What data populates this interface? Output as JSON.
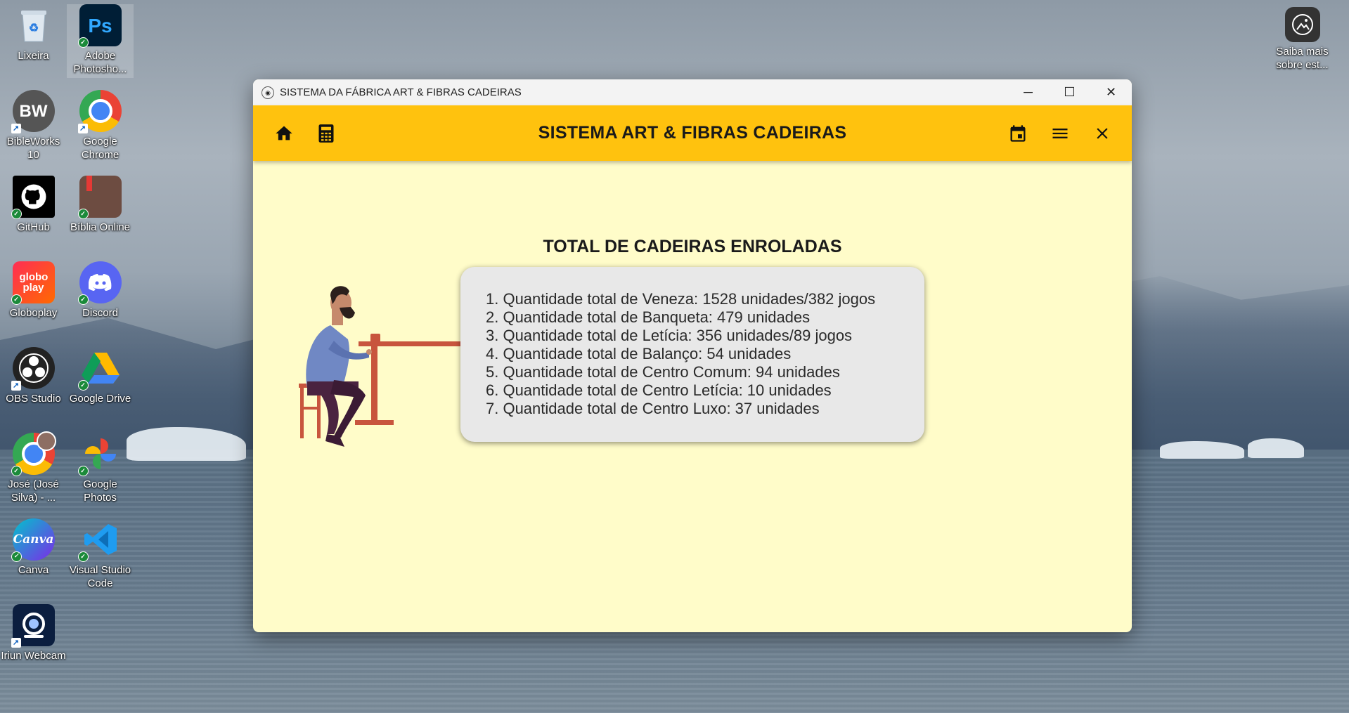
{
  "desktop": {
    "icons": [
      {
        "label": "Lixeira",
        "icon": "recycle-bin-icon"
      },
      {
        "label": "Adobe Photosho...",
        "icon": "photoshop-icon",
        "glyph": "Ps"
      },
      {
        "label": "BibleWorks 10",
        "icon": "bibleworks-icon",
        "glyph": "BW"
      },
      {
        "label": "Google Chrome",
        "icon": "chrome-icon"
      },
      {
        "label": "GitHub",
        "icon": "github-icon"
      },
      {
        "label": "Bíblia Online",
        "icon": "bible-online-icon"
      },
      {
        "label": "Globoplay",
        "icon": "globoplay-icon",
        "glyph": "globo play"
      },
      {
        "label": "Discord",
        "icon": "discord-icon"
      },
      {
        "label": "OBS Studio",
        "icon": "obs-icon"
      },
      {
        "label": "Google Drive",
        "icon": "google-drive-icon"
      },
      {
        "label": "José (José Silva) - ...",
        "icon": "chrome-profile-icon"
      },
      {
        "label": "Google Photos",
        "icon": "google-photos-icon"
      },
      {
        "label": "Canva",
        "icon": "canva-icon",
        "glyph": "Canva"
      },
      {
        "label": "Visual Studio Code",
        "icon": "vscode-icon"
      },
      {
        "label": "Iriun Webcam",
        "icon": "iriun-webcam-icon"
      },
      {
        "label": "Saiba mais sobre est...",
        "icon": "learn-more-icon"
      }
    ]
  },
  "window": {
    "title": "SISTEMA DA FÁBRICA ART & FIBRAS CADEIRAS",
    "minimize": "─",
    "maximize": "☐",
    "close": "✕"
  },
  "appbar": {
    "title": "SISTEMA ART & FIBRAS CADEIRAS",
    "left_icons": [
      "home-icon",
      "calculator-icon"
    ],
    "right_icons": [
      "calendar-icon",
      "menu-icon",
      "close-icon"
    ]
  },
  "main": {
    "heading": "TOTAL DE CADEIRAS ENROLADAS",
    "items": [
      "1. Quantidade total de Veneza: 1528 unidades/382 jogos",
      "2. Quantidade total de Banqueta: 479 unidades",
      "3. Quantidade total de Letícia: 356 unidades/89 jogos",
      "4. Quantidade total de Balanço: 54 unidades",
      "5. Quantidade total de Centro Comum: 94 unidades",
      "6. Quantidade total de Centro Letícia: 10 unidades",
      "7. Quantidade total de Centro Luxo: 37 unidades"
    ]
  },
  "colors": {
    "appbar": "#ffc20e",
    "background": "#fffcc9",
    "card": "#e8e8e8"
  }
}
